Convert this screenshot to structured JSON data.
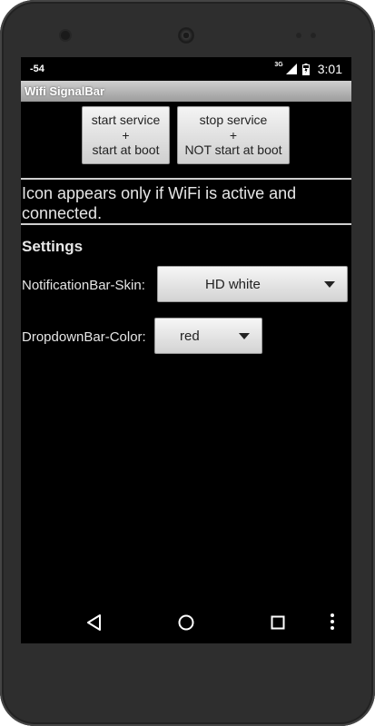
{
  "status_bar": {
    "left_text": "-54",
    "network_type": "3G",
    "time": "3:01"
  },
  "app": {
    "title": "Wifi SignalBar"
  },
  "buttons": {
    "start": {
      "line1": "start service",
      "line2": "+",
      "line3": "start at boot"
    },
    "stop": {
      "line1": "stop service",
      "line2": "+",
      "line3": "NOT start at boot"
    }
  },
  "info_text": "Icon appears only if WiFi is active and connected.",
  "settings": {
    "heading": "Settings",
    "notification_skin": {
      "label": "NotificationBar-Skin:",
      "value": "HD white"
    },
    "dropdown_color": {
      "label": "DropdownBar-Color:",
      "value": "red"
    }
  },
  "icons": {
    "signal": "signal-icon",
    "battery": "battery-icon",
    "back": "back-icon",
    "home": "home-icon",
    "recents": "recents-icon",
    "menu": "overflow-menu-icon"
  },
  "colors": {
    "screen_background": "#000000",
    "title_bar": "#b8b8b8",
    "text": "#e6e6e6",
    "device_frame": "#2e2e2e"
  }
}
